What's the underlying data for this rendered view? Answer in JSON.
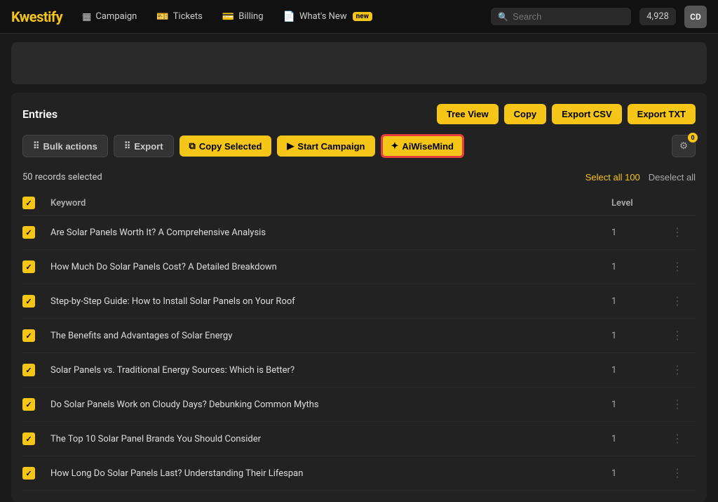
{
  "app": {
    "logo": "Kwestify"
  },
  "nav": {
    "items": [
      {
        "id": "campaign",
        "icon": "▦",
        "label": "Campaign"
      },
      {
        "id": "tickets",
        "icon": "🎫",
        "label": "Tickets"
      },
      {
        "id": "billing",
        "icon": "💳",
        "label": "Billing"
      },
      {
        "id": "whats-new",
        "icon": "📄",
        "label": "What's New",
        "badge": "new"
      }
    ],
    "search_placeholder": "Search",
    "credits": "4,928",
    "avatar": "CD"
  },
  "entries": {
    "title": "Entries",
    "buttons": {
      "tree_view": "Tree View",
      "copy": "Copy",
      "export_csv": "Export CSV",
      "export_txt": "Export TXT"
    },
    "toolbar": {
      "bulk_actions": "Bulk actions",
      "export": "Export",
      "copy_selected": "Copy Selected",
      "start_campaign": "Start Campaign",
      "aiwisemind": "AiWiseMind",
      "filter_count": "0"
    },
    "selection": {
      "count": "50 records selected",
      "select_all": "Select all 100",
      "deselect_all": "Deselect all"
    },
    "table": {
      "headers": [
        "",
        "Keyword",
        "Level",
        ""
      ],
      "rows": [
        {
          "keyword": "Are Solar Panels Worth It? A Comprehensive Analysis",
          "level": "1"
        },
        {
          "keyword": "How Much Do Solar Panels Cost? A Detailed Breakdown",
          "level": "1"
        },
        {
          "keyword": "Step-by-Step Guide: How to Install Solar Panels on Your Roof",
          "level": "1"
        },
        {
          "keyword": "The Benefits and Advantages of Solar Energy",
          "level": "1"
        },
        {
          "keyword": "Solar Panels vs. Traditional Energy Sources: Which is Better?",
          "level": "1"
        },
        {
          "keyword": "Do Solar Panels Work on Cloudy Days? Debunking Common Myths",
          "level": "1"
        },
        {
          "keyword": "The Top 10 Solar Panel Brands You Should Consider",
          "level": "1"
        },
        {
          "keyword": "How Long Do Solar Panels Last? Understanding Their Lifespan",
          "level": "1"
        }
      ]
    }
  }
}
